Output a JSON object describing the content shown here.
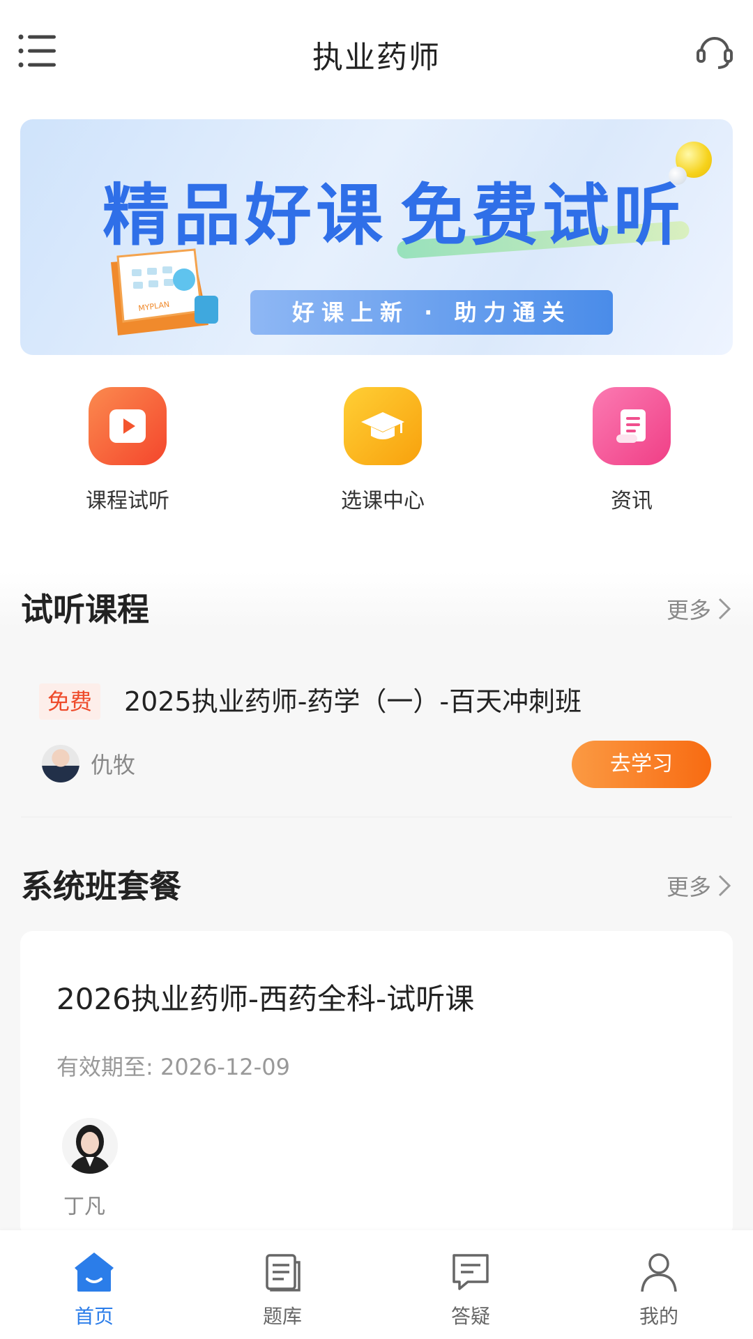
{
  "header": {
    "title": "执业药师",
    "menu_icon": "menu-list-icon",
    "service_icon": "headset-icon"
  },
  "banner": {
    "headline_left": "精品好课",
    "headline_right": "免费试听",
    "subtitle": "好课上新 · 助力通关",
    "calendar_text": "MYPLAN"
  },
  "quick_entries": [
    {
      "label": "课程试听",
      "icon": "play-icon",
      "color": "#f6653a"
    },
    {
      "label": "选课中心",
      "icon": "graduation-cap-icon",
      "color": "#fbb21b"
    },
    {
      "label": "资讯",
      "icon": "scroll-icon",
      "color": "#f5579a"
    }
  ],
  "trial_section": {
    "title": "试听课程",
    "more": "更多",
    "course": {
      "tag": "免费",
      "title": "2025执业药师-药学（一）-百天冲刺班",
      "teacher": "仇牧",
      "action": "去学习"
    }
  },
  "package_section": {
    "title": "系统班套餐",
    "more": "更多",
    "card": {
      "title": "2026执业药师-西药全科-试听课",
      "valid_until": "有效期至: 2026-12-09",
      "teacher": "丁凡"
    }
  },
  "tabbar": [
    {
      "label": "首页",
      "icon": "home-icon",
      "active": true
    },
    {
      "label": "题库",
      "icon": "question-bank-icon",
      "active": false
    },
    {
      "label": "答疑",
      "icon": "qa-chat-icon",
      "active": false
    },
    {
      "label": "我的",
      "icon": "user-icon",
      "active": false
    }
  ],
  "colors": {
    "accent_blue": "#2b7de9",
    "accent_orange": "#f86b12",
    "free_tag": "#ee4a2a"
  }
}
